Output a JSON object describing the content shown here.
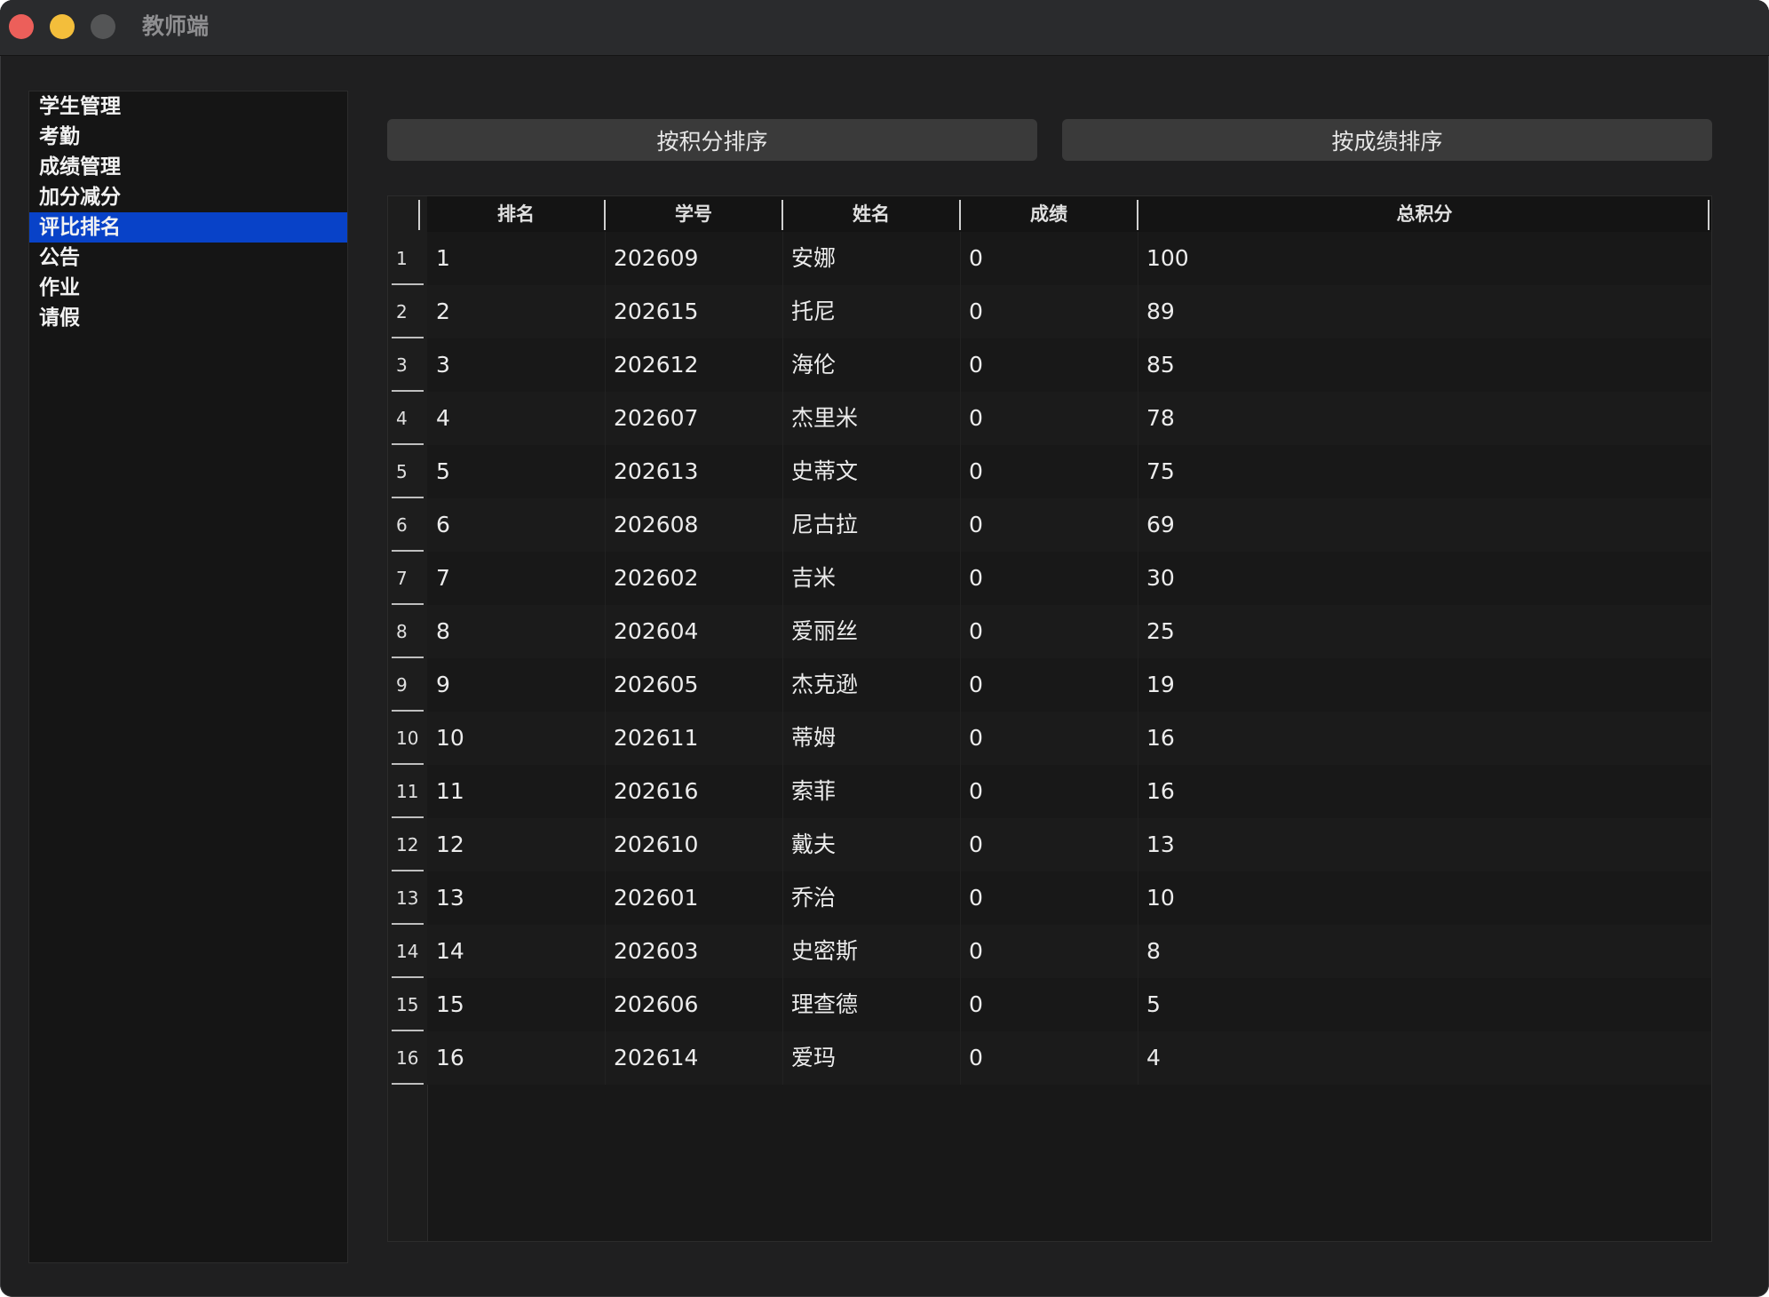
{
  "window": {
    "title": "教师端"
  },
  "sidebar": {
    "items": [
      {
        "label": "学生管理",
        "selected": false
      },
      {
        "label": "考勤",
        "selected": false
      },
      {
        "label": "成绩管理",
        "selected": false
      },
      {
        "label": "加分减分",
        "selected": false
      },
      {
        "label": "评比排名",
        "selected": true
      },
      {
        "label": "公告",
        "selected": false
      },
      {
        "label": "作业",
        "selected": false
      },
      {
        "label": "请假",
        "selected": false
      }
    ]
  },
  "toolbar": {
    "sort_by_points_label": "按积分排序",
    "sort_by_score_label": "按成绩排序"
  },
  "table": {
    "columns": [
      "排名",
      "学号",
      "姓名",
      "成绩",
      "总积分"
    ],
    "rows": [
      {
        "num": "1",
        "rank": "1",
        "id": "202609",
        "name": "安娜",
        "score": "0",
        "points": "100"
      },
      {
        "num": "2",
        "rank": "2",
        "id": "202615",
        "name": "托尼",
        "score": "0",
        "points": "89"
      },
      {
        "num": "3",
        "rank": "3",
        "id": "202612",
        "name": "海伦",
        "score": "0",
        "points": "85"
      },
      {
        "num": "4",
        "rank": "4",
        "id": "202607",
        "name": "杰里米",
        "score": "0",
        "points": "78"
      },
      {
        "num": "5",
        "rank": "5",
        "id": "202613",
        "name": "史蒂文",
        "score": "0",
        "points": "75"
      },
      {
        "num": "6",
        "rank": "6",
        "id": "202608",
        "name": "尼古拉",
        "score": "0",
        "points": "69"
      },
      {
        "num": "7",
        "rank": "7",
        "id": "202602",
        "name": "吉米",
        "score": "0",
        "points": "30"
      },
      {
        "num": "8",
        "rank": "8",
        "id": "202604",
        "name": "爱丽丝",
        "score": "0",
        "points": "25"
      },
      {
        "num": "9",
        "rank": "9",
        "id": "202605",
        "name": "杰克逊",
        "score": "0",
        "points": "19"
      },
      {
        "num": "10",
        "rank": "10",
        "id": "202611",
        "name": "蒂姆",
        "score": "0",
        "points": "16"
      },
      {
        "num": "11",
        "rank": "11",
        "id": "202616",
        "name": "索菲",
        "score": "0",
        "points": "16"
      },
      {
        "num": "12",
        "rank": "12",
        "id": "202610",
        "name": "戴夫",
        "score": "0",
        "points": "13"
      },
      {
        "num": "13",
        "rank": "13",
        "id": "202601",
        "name": "乔治",
        "score": "0",
        "points": "10"
      },
      {
        "num": "14",
        "rank": "14",
        "id": "202603",
        "name": "史密斯",
        "score": "0",
        "points": "8"
      },
      {
        "num": "15",
        "rank": "15",
        "id": "202606",
        "name": "理查德",
        "score": "0",
        "points": "5"
      },
      {
        "num": "16",
        "rank": "16",
        "id": "202614",
        "name": "爱玛",
        "score": "0",
        "points": "4"
      }
    ]
  }
}
